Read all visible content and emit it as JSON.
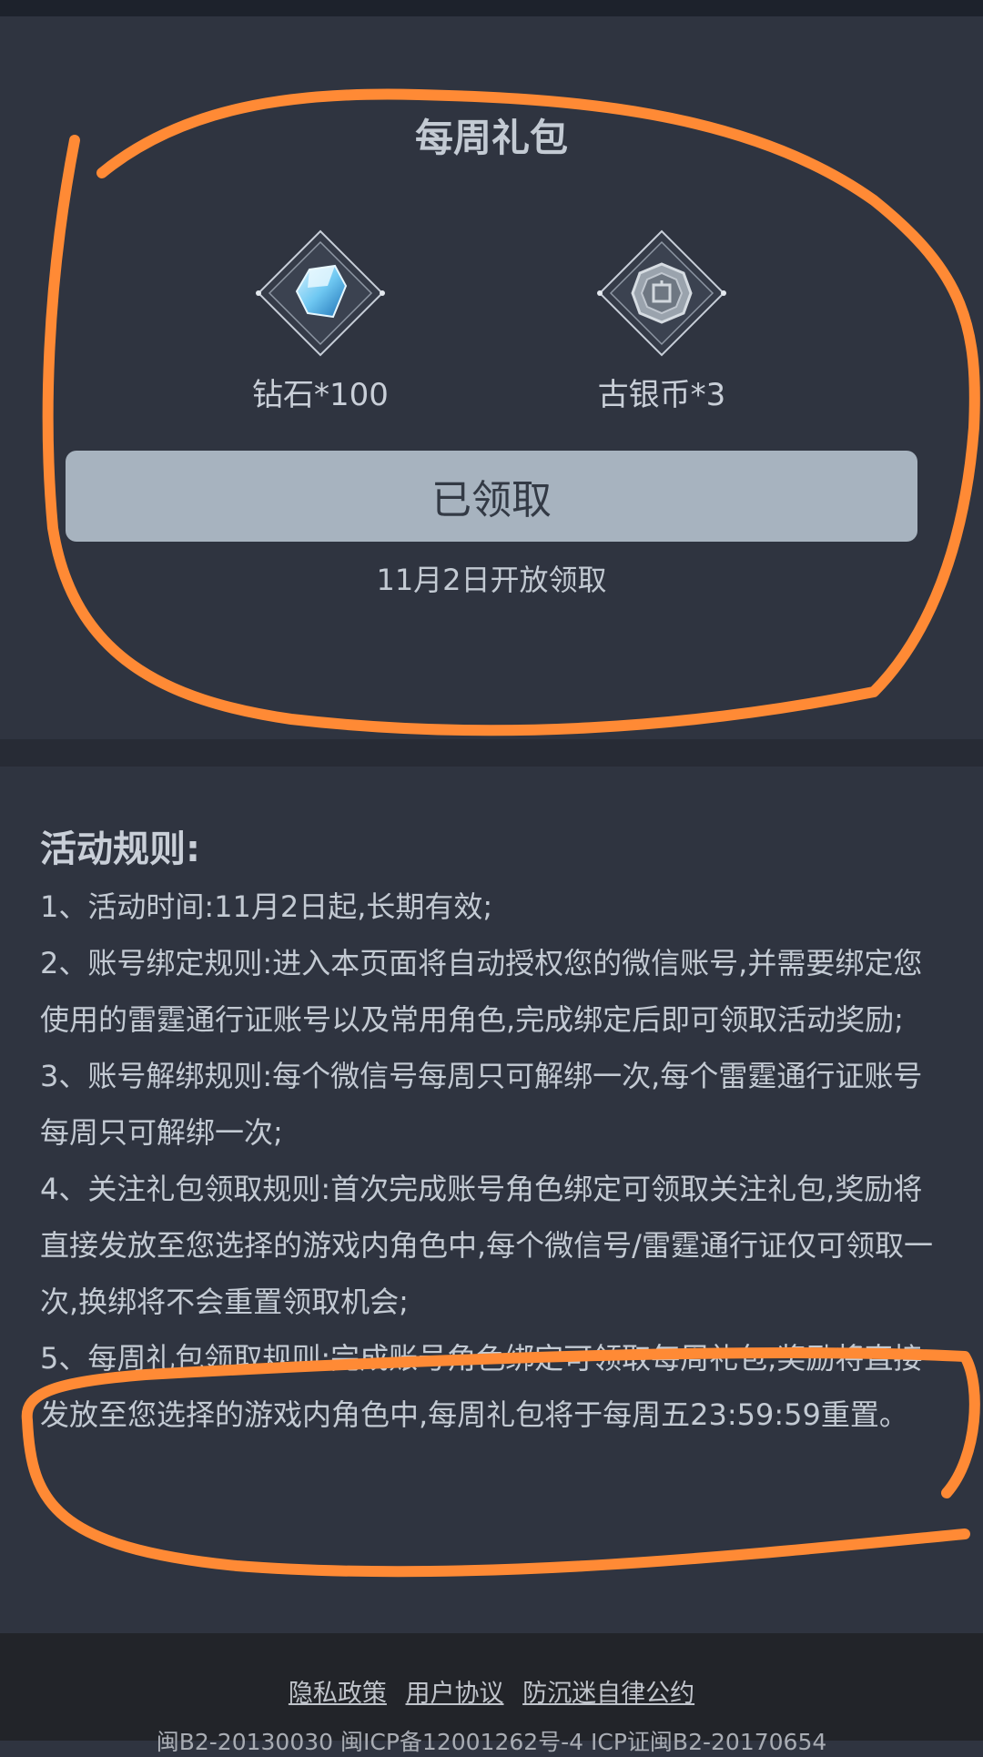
{
  "weekly_gift": {
    "title": "每周礼包",
    "rewards": [
      {
        "icon": "diamond-icon",
        "label": "钻石*100"
      },
      {
        "icon": "silver-coin-icon",
        "label": "古银币*3"
      }
    ],
    "claim_button_label": "已领取",
    "open_note": "11月2日开放领取"
  },
  "rules": {
    "heading": "活动规则:",
    "items": [
      "1、活动时间:11月2日起,长期有效;",
      "2、账号绑定规则:进入本页面将自动授权您的微信账号,并需要绑定您使用的雷霆通行证账号以及常用角色,完成绑定后即可领取活动奖励;",
      "3、账号解绑规则:每个微信号每周只可解绑一次,每个雷霆通行证账号每周只可解绑一次;",
      "4、关注礼包领取规则:首次完成账号角色绑定可领取关注礼包,奖励将直接发放至您选择的游戏内角色中,每个微信号/雷霆通行证仅可领取一次,换绑将不会重置领取机会;",
      "5、每周礼包领取规则:完成账号角色绑定可领取每周礼包,奖励将直接发放至您选择的游戏内角色中,每周礼包将于每周五23:59:59重置。"
    ]
  },
  "footer": {
    "links": [
      "隐私政策",
      "用户协议",
      "防沉迷自律公约"
    ],
    "license": "闽B2-20130030 闽ICP备12001262号-4 ICP证闽B2-20170654"
  },
  "colors": {
    "background": "#2f3440",
    "button": "#a7b3bf",
    "annotation_stroke": "#ff8a35",
    "footer_bg": "#222429"
  }
}
